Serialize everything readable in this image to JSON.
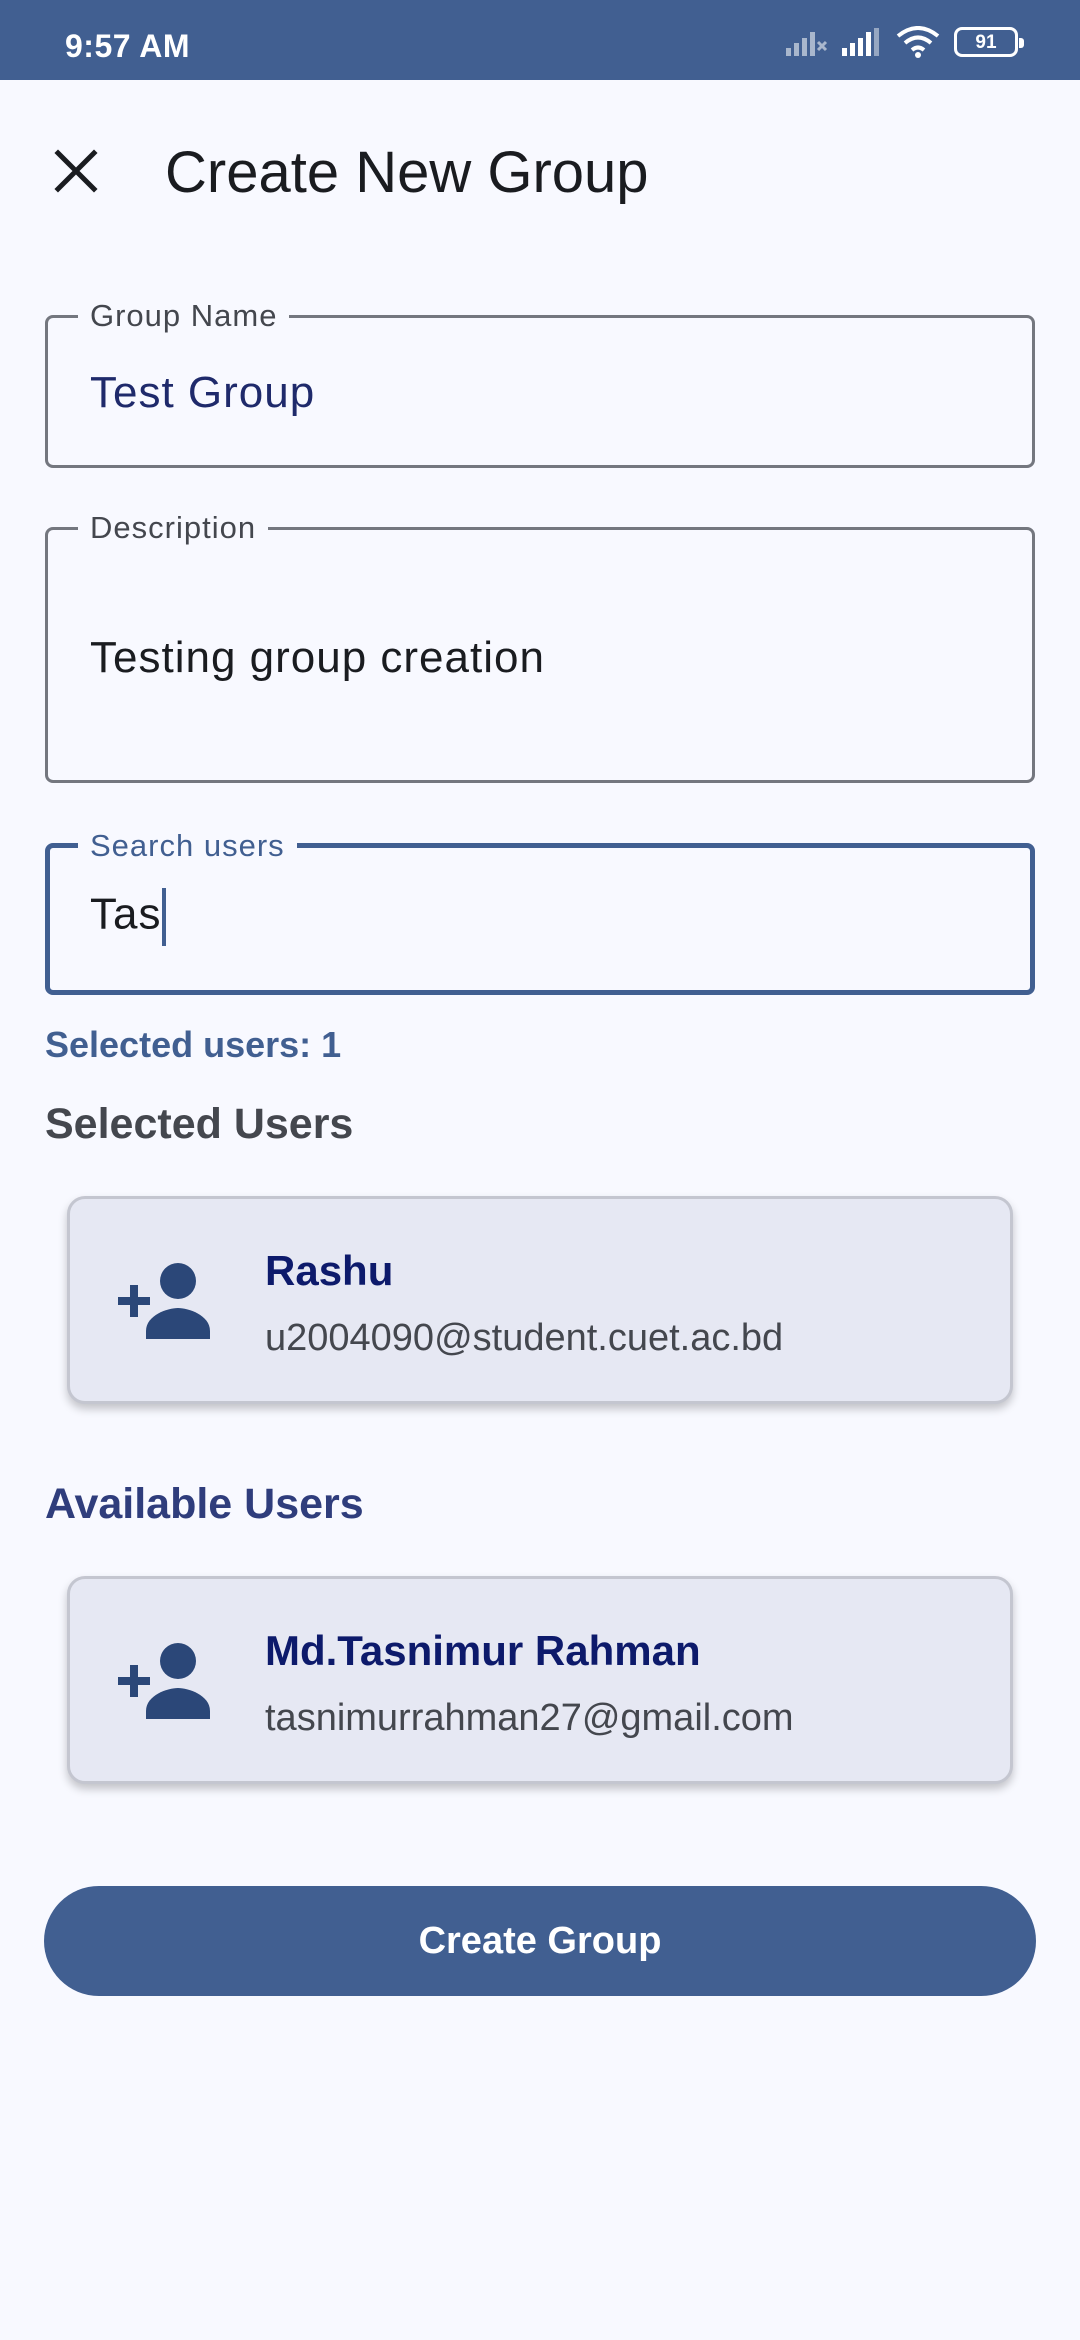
{
  "status_bar": {
    "time": "9:57 AM",
    "battery": "91",
    "icons": [
      "signal-x-icon",
      "cellular-signal-icon",
      "wifi-icon",
      "battery-icon"
    ]
  },
  "header": {
    "title": "Create New Group",
    "close_icon": "close-icon"
  },
  "form": {
    "group_name": {
      "label": "Group Name",
      "value": "Test Group"
    },
    "description": {
      "label": "Description",
      "value": "Testing group creation"
    },
    "search": {
      "label": "Search users",
      "value": "Tas"
    }
  },
  "selected_count": "Selected users: 1",
  "selected_section": {
    "title": "Selected Users",
    "users": [
      {
        "name": "Rashu",
        "email": "u2004090@student.cuet.ac.bd",
        "icon": "person-add-icon"
      }
    ]
  },
  "available_section": {
    "title": "Available Users",
    "users": [
      {
        "name": "Md.Tasnimur Rahman",
        "email": "tasnimurrahman27@gmail.com",
        "icon": "person-add-icon"
      }
    ]
  },
  "actions": {
    "create_label": "Create Group"
  },
  "colors": {
    "primary": "#415f91",
    "background": "#f8f9ff",
    "card": "#e6e8f3",
    "name_text": "#0d1a6b",
    "available_title": "#2f3d7c",
    "selected_title": "#44474e"
  }
}
